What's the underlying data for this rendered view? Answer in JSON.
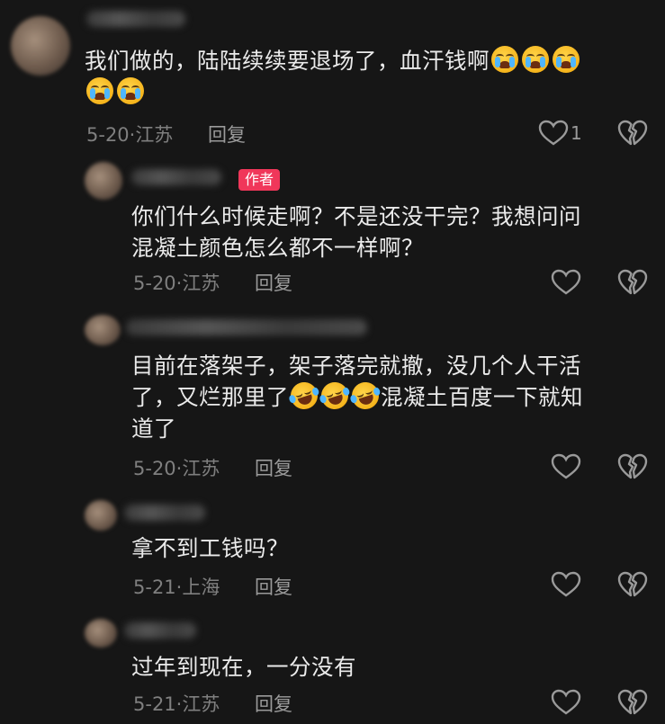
{
  "comments": [
    {
      "text_line1": "我们做的，陆陆续续要退场了，血汗钱啊",
      "date": "5-20",
      "location": "江苏",
      "reply_label": "回复",
      "like_count": "1"
    },
    {
      "author_badge": "作者",
      "text_line1": "你们什么时候走啊？不是还没干完？我想问问",
      "text_line2": "混凝土颜色怎么都不一样啊？",
      "date": "5-20",
      "location": "江苏",
      "reply_label": "回复"
    },
    {
      "text_line1": "目前在落架子，架子落完就撤，没几个人干活",
      "text_line2a": "了，又烂那里了",
      "text_line2b": "混凝土百度一下就知",
      "text_line3": "道了",
      "date": "5-20",
      "location": "江苏",
      "reply_label": "回复"
    },
    {
      "text_line1": "拿不到工钱吗？",
      "date": "5-21",
      "location": "上海",
      "reply_label": "回复"
    },
    {
      "text_line1": "过年到现在，一分没有",
      "date": "5-21",
      "location": "江苏",
      "reply_label": "回复"
    }
  ],
  "icons": {
    "like": "heart-outline-icon",
    "dislike": "broken-heart-icon",
    "emoji_cry": "loudly-crying-face-emoji",
    "emoji_laugh": "rolling-on-floor-laughing-emoji"
  },
  "colors": {
    "background": "#161616",
    "author_badge": "#f0375a",
    "meta": "#7f7f7f"
  }
}
